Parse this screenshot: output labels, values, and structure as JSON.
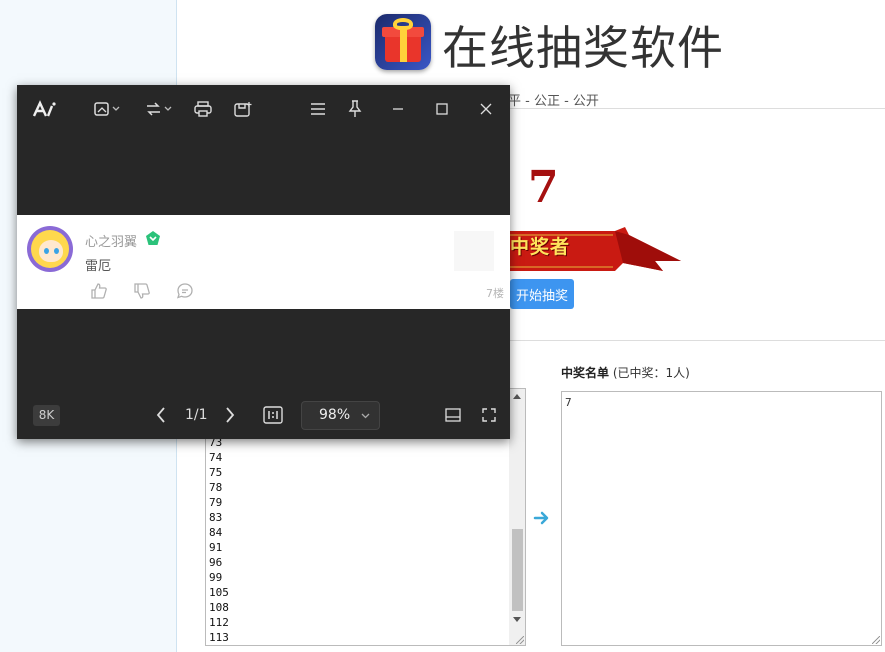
{
  "header": {
    "title": "在线抽奖软件",
    "subtitle": "平 - 公正 - 公开"
  },
  "result": {
    "winner_number": "7",
    "banner_label": "中奖者",
    "start_button": "开始抽奖"
  },
  "winners": {
    "heading_bold": "中奖名单",
    "heading_rest": " (已中奖：1人)",
    "list_text": "7"
  },
  "candidates": [
    "73",
    "74",
    "75",
    "78",
    "79",
    "83",
    "84",
    "91",
    "96",
    "99",
    "105",
    "108",
    "112",
    "113"
  ],
  "viewer": {
    "toolbar_icons": [
      "app-logo-icon",
      "edit-image-icon",
      "rotate-icon",
      "print-icon",
      "save-icon",
      "menu-icon",
      "pin-icon",
      "minimize-icon",
      "maximize-icon",
      "close-icon"
    ],
    "comment": {
      "username": "心之羽翼",
      "text": "雷厄",
      "floor": "7楼"
    },
    "resolution_badge": "8K",
    "page_indicator": "1/1",
    "zoom_value": "98%"
  },
  "colors": {
    "winner_red": "#a51010",
    "button_blue": "#3d95f0",
    "viewer_bg": "#272727",
    "badge_green": "#2bc27a"
  }
}
